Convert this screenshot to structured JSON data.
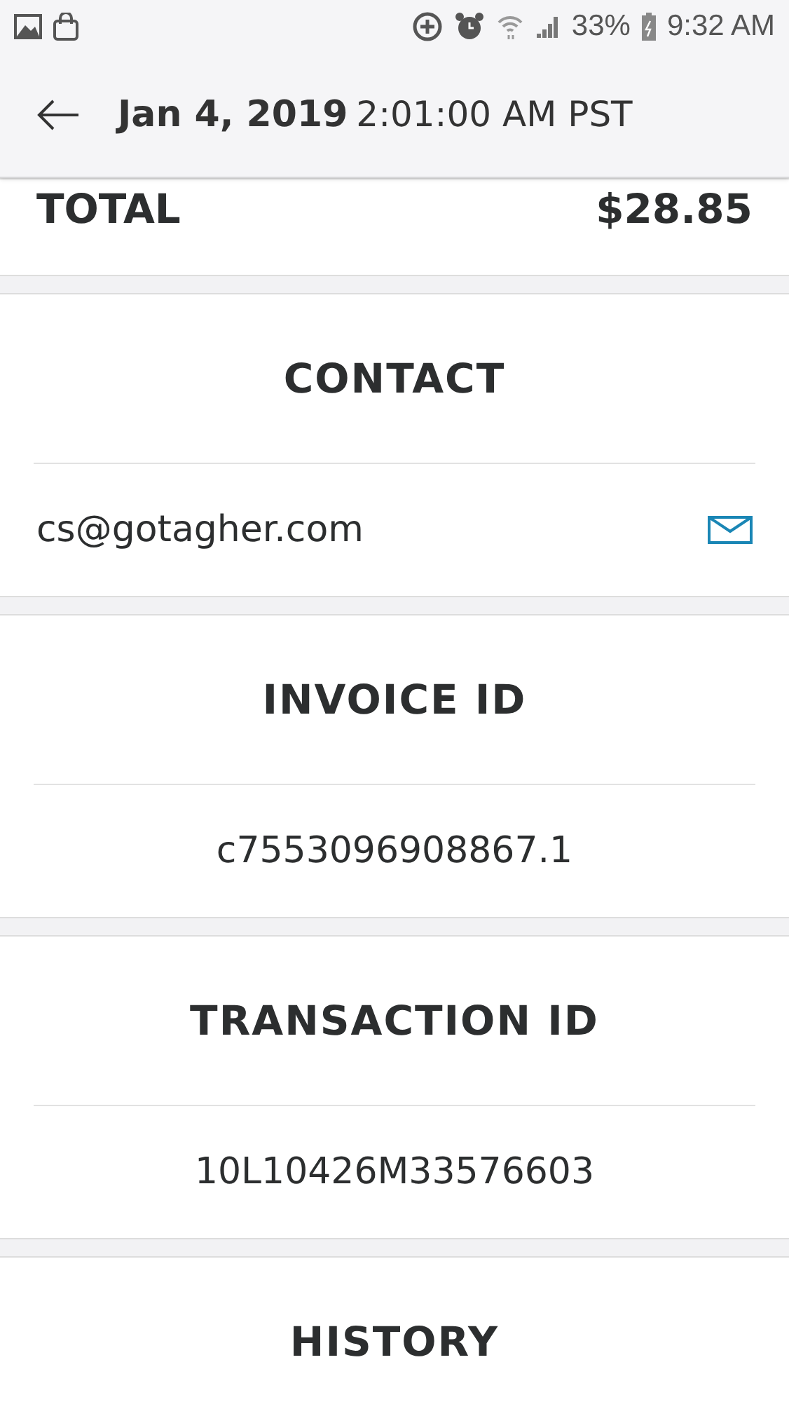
{
  "status_bar": {
    "battery": "33%",
    "time": "9:32 AM"
  },
  "header": {
    "date": "Jan 4, 2019",
    "time": "2:01:00 AM PST"
  },
  "total": {
    "label": "TOTAL",
    "amount": "$28.85"
  },
  "sections": [
    {
      "heading": "CONTACT",
      "value": "cs@gotagher.com",
      "kind": "email"
    },
    {
      "heading": "INVOICE ID",
      "value": "c7553096908867.1",
      "kind": "plain"
    },
    {
      "heading": "TRANSACTION ID",
      "value": "10L10426M33576603",
      "kind": "plain"
    },
    {
      "heading": "HISTORY"
    }
  ]
}
